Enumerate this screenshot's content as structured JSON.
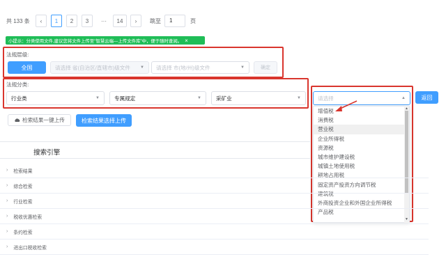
{
  "pagination": {
    "total": "共 133 条",
    "prev": "‹",
    "pages": [
      "1",
      "2",
      "3"
    ],
    "ellipsis": "···",
    "last": "14",
    "next": "›",
    "jump_label": "跳至",
    "jump_value": "1",
    "unit": "页"
  },
  "tip": {
    "text": "小提示：分类使用文件,建议您将文件上传至\"智慧云端—上传文件库\"中，便于随时查阅。",
    "close": "×"
  },
  "level": {
    "label": "法规层级:",
    "national": "全国",
    "province_placeholder": "请选择 省(自治区/直辖市)级文件",
    "city_placeholder": "请选择 市(地/州)级文件",
    "confirm": "确定"
  },
  "category": {
    "label": "法规分类:",
    "selects": [
      "行业类",
      "专属规定",
      "采矿业"
    ],
    "open_placeholder": "请选择",
    "return": "返回"
  },
  "buttons": {
    "upload_all": "检索结果一键上传",
    "upload_selected": "检索结果选择上传"
  },
  "search_engine": "搜索引擎",
  "accordion": [
    "检索结果",
    "综合检索",
    "行业检索",
    "税收优惠检索",
    "条约检索",
    "进出口税收检索"
  ],
  "dropdown_options": [
    "增值税",
    "消费税",
    "营业税",
    "企业所得税",
    "资源税",
    "城市维护建设税",
    "城镇土地使用税",
    "耕地占用税",
    "固定资产投资方向调节税",
    "建筑税",
    "外商投资企业和外国企业所得税",
    "产品税"
  ],
  "colors": {
    "primary": "#409eff",
    "annotation_red": "#d9352d",
    "tip_green": "#1fbd57"
  }
}
